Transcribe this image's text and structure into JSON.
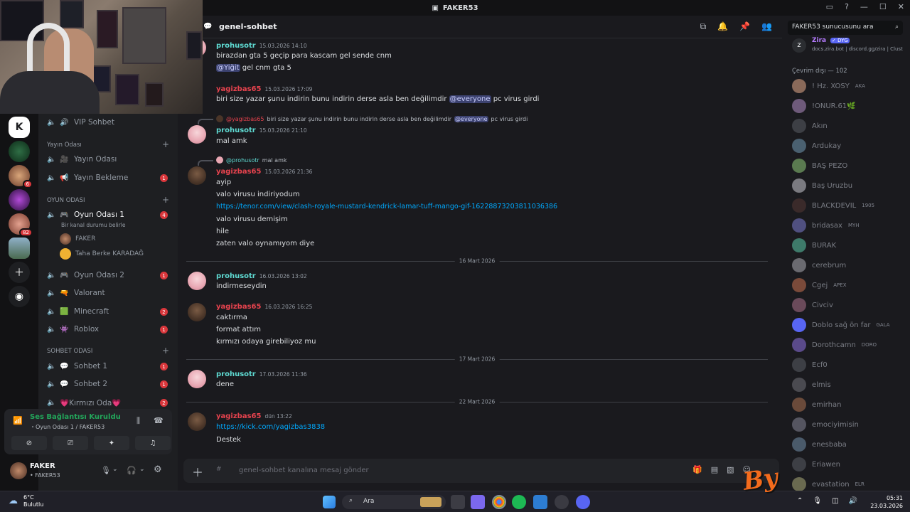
{
  "window": {
    "title": "FAKER53"
  },
  "channel": {
    "name": "genel-sohbet",
    "composer_placeholder": "genel-sohbet kanalına mesaj gönder",
    "search_placeholder": "FAKER53 sunucusunu ara"
  },
  "sidebar": {
    "top_channel": "VIP Sohbet",
    "categories": {
      "yayin": "Yayın Odası",
      "oyun": "OYUN ODASI",
      "sohbet": "SOHBET ODASI"
    },
    "channels": {
      "yayin_odasi": "Yayın Odası",
      "yayin_bekleme": "Yayın Bekleme",
      "oyun_odasi_1": "Oyun Odası 1",
      "oyun_odasi_1_status": "Bir kanal durumu belirle",
      "oyun_odasi_2": "Oyun Odası 2",
      "valorant": "Valorant",
      "minecraft": "Minecraft",
      "roblox": "Roblox",
      "sohbet_1": "Sohbet 1",
      "sohbet_2": "Sohbet 2",
      "kirmizi_oda": "💗Kırmızı Oda💗"
    },
    "badges": {
      "yayin_bekleme": "1",
      "oyun_odasi_1": "4",
      "oyun_odasi_2": "1",
      "minecraft": "2",
      "roblox": "1",
      "sohbet_1": "1",
      "sohbet_2": "1",
      "kirmizi_oda": "2"
    },
    "voice_users": [
      "FAKER",
      "Taha Berke KARADAĞ"
    ],
    "guild_badges": {
      "g3": "6",
      "g5": "82"
    }
  },
  "voice_panel": {
    "status": "Ses Bağlantısı Kuruldu",
    "location": "・Oyun Odası 1 / FAKER53"
  },
  "user_panel": {
    "name": "FAKER",
    "sub": "• FAKER53"
  },
  "messages": {
    "m1": {
      "author": "prohusotr",
      "time": "15.03.2026 14:10",
      "lines": [
        "birazdan gta 5 geçip para kascam gel sende cnm"
      ],
      "mention": "@Yiğit",
      "after_mention": " gel cnm gta 5"
    },
    "m2": {
      "author": "yagizbas65",
      "time": "15.03.2026 17:09",
      "text_before": "biri size yazar şunu indirin bunu indirin derse asla ben değilimdir ",
      "mention": "@everyone",
      "text_after": " pc virus girdi"
    },
    "m3": {
      "reply_author": "@yagizbas65",
      "reply_before": "biri size yazar şunu indirin bunu indirin derse asla ben değilimdir ",
      "reply_mention": "@everyone",
      "reply_after": " pc virus girdi",
      "author": "prohusotr",
      "time": "15.03.2026 21:10",
      "text": "mal amk"
    },
    "m4": {
      "reply_author": "@prohusotr",
      "reply_text": "mal amk",
      "author": "yagizbas65",
      "time": "15.03.2026 21:36",
      "l1": "ayip",
      "l2": "valo virusu indiriyodum",
      "link": "https://tenor.com/view/clash-royale-mustard-kendrick-lamar-tuff-mango-gif-16228873203811036386",
      "l3": "valo virusu demişim",
      "l4": "hile",
      "l5": "zaten valo oynamıyom diye"
    },
    "d1": "16 Mart 2026",
    "m5": {
      "author": "prohusotr",
      "time": "16.03.2026 13:02",
      "text": "indirmeseydin"
    },
    "m6": {
      "author": "yagizbas65",
      "time": "16.03.2026 16:25",
      "l1": "caktırma",
      "l2": "format attım",
      "l3": "kırmızı odaya girebiliyoz mu"
    },
    "d2": "17 Mart 2026",
    "m7": {
      "author": "prohusotr",
      "time": "17.03.2026 11:36",
      "text": "dene"
    },
    "d3": "22 Mart 2026",
    "m8": {
      "author": "yagizbas65",
      "time": "dün 13:22",
      "link": "https://kick.com/yagizbas3838",
      "text": "Destek"
    }
  },
  "members": {
    "bot": {
      "name": "Zira",
      "tag": "✓ DYG",
      "status": "docs.zira.bot | discord.gg/zira | Clust"
    },
    "offline_header": "Çevrim dışı — 102",
    "list": [
      {
        "name": "! Hz. XOSY",
        "tag": "AKA"
      },
      {
        "name": "!ONUR.61🌿",
        "tag": ""
      },
      {
        "name": "Akın",
        "tag": ""
      },
      {
        "name": "Ardukay",
        "tag": ""
      },
      {
        "name": "BAŞ PEZO",
        "tag": ""
      },
      {
        "name": "Baş Uruzbu",
        "tag": ""
      },
      {
        "name": "BLACKDEVIL",
        "tag": "1905"
      },
      {
        "name": "bridasax",
        "tag": "MYH"
      },
      {
        "name": "BURAK",
        "tag": ""
      },
      {
        "name": "cerebrum",
        "tag": ""
      },
      {
        "name": "Cgej",
        "tag": "APEX"
      },
      {
        "name": "Civciv",
        "tag": ""
      },
      {
        "name": "Doblo sağ ön far",
        "tag": "GALA"
      },
      {
        "name": "Dorothcamn",
        "tag": "DORO"
      },
      {
        "name": "Ecf0",
        "tag": ""
      },
      {
        "name": "elmis",
        "tag": ""
      },
      {
        "name": "emirhan",
        "tag": ""
      },
      {
        "name": "emociyimisin",
        "tag": ""
      },
      {
        "name": "enesbaba",
        "tag": ""
      },
      {
        "name": "Eriawen",
        "tag": ""
      },
      {
        "name": "evastation",
        "tag": "ELR"
      }
    ]
  },
  "taskbar": {
    "temp": "6°C",
    "weather": "Bulutlu",
    "search": "Ara",
    "time": "05:31",
    "date": "23.03.2026"
  },
  "watermark": "By"
}
